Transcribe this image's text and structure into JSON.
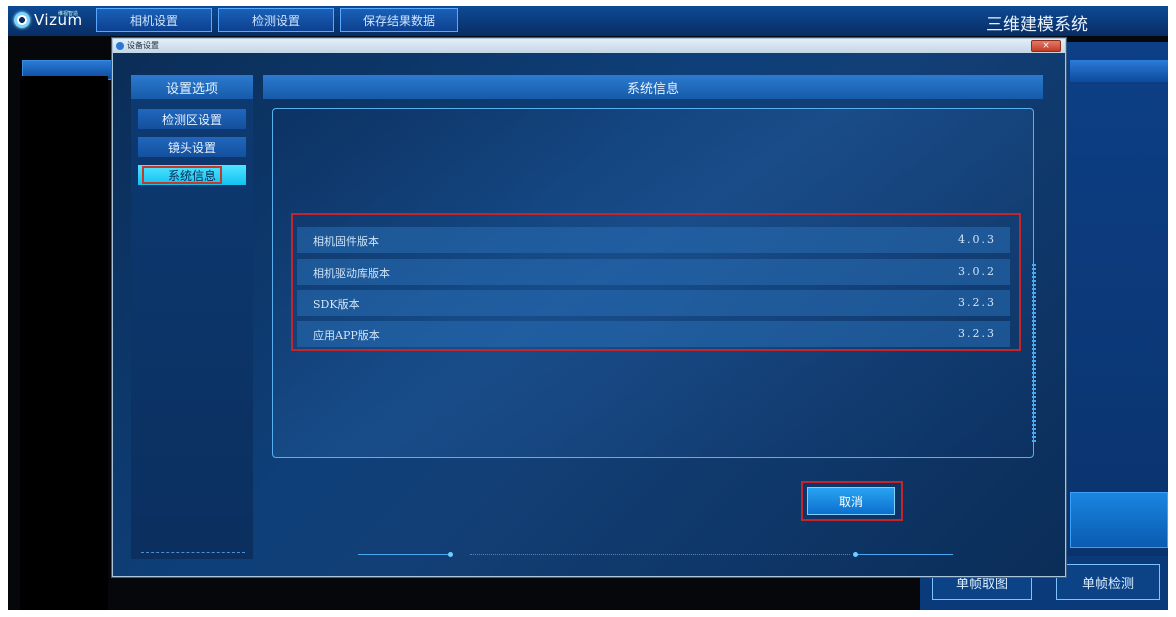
{
  "app": {
    "logo_text": "Vizum",
    "logo_sup": "维视智造",
    "title": "三维建模系统",
    "top_buttons": [
      "相机设置",
      "检测设置",
      "保存结果数据"
    ]
  },
  "background": {
    "buttons": [
      "单帧取图",
      "单帧检测"
    ]
  },
  "dialog": {
    "title": "设备设置",
    "close_glyph": "×",
    "sidebar": {
      "header": "设置选项",
      "items": [
        "检测区设置",
        "镜头设置",
        "系统信息"
      ],
      "active_index": 2
    },
    "main": {
      "header": "系统信息",
      "rows": [
        {
          "label": "相机固件版本",
          "value": "4.0.3"
        },
        {
          "label": "相机驱动库版本",
          "value": "3.0.2"
        },
        {
          "label": "SDK版本",
          "value": "3.2.3"
        },
        {
          "label": "应用APP版本",
          "value": "3.2.3"
        }
      ]
    },
    "cancel_label": "取消"
  },
  "colors": {
    "accent": "#1a61b7",
    "highlight_border": "#c2252c",
    "active_item": "#4fe4ff"
  }
}
